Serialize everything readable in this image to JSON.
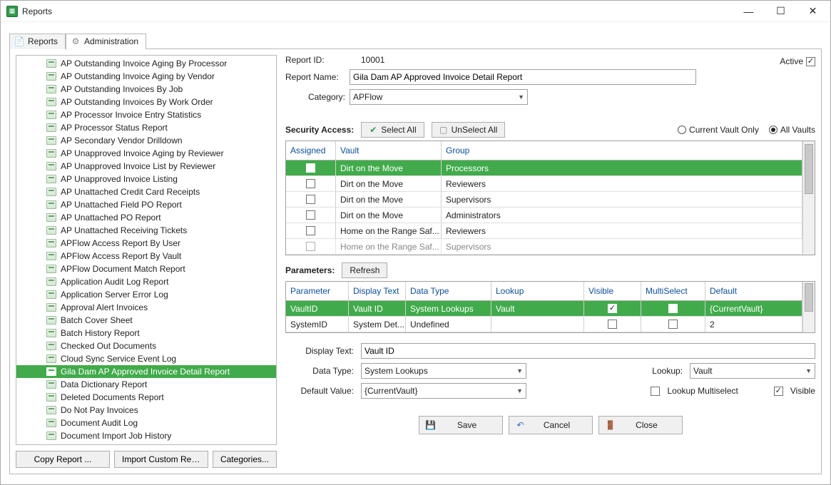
{
  "window": {
    "title": "Reports"
  },
  "tabs": {
    "reports": "Reports",
    "administration": "Administration"
  },
  "tree_items": [
    "AP Outstanding Invoice Aging By Processor",
    "AP Outstanding Invoice Aging by Vendor",
    "AP Outstanding Invoices By Job",
    "AP Outstanding Invoices By Work Order",
    "AP Processor Invoice Entry Statistics",
    "AP Processor Status Report",
    "AP Secondary Vendor Drilldown",
    "AP Unapproved Invoice Aging by Reviewer",
    "AP Unapproved Invoice List by Reviewer",
    "AP Unapproved Invoice Listing",
    "AP Unattached Credit Card Receipts",
    "AP Unattached Field PO Report",
    "AP Unattached PO Report",
    "AP Unattached Receiving Tickets",
    "APFlow Access Report By User",
    "APFlow Access Report By Vault",
    "APFlow Document Match Report",
    "Application Audit Log Report",
    "Application Server Error Log",
    "Approval Alert Invoices",
    "Batch Cover Sheet",
    "Batch History Report",
    "Checked Out Documents",
    "Cloud Sync Service Event Log",
    "Gila Dam AP Approved Invoice Detail Report",
    "Data Dictionary Report",
    "Deleted Documents Report",
    "Do Not Pay Invoices",
    "Document Audit Log",
    "Document Import Job History"
  ],
  "tree_selected_index": 24,
  "left_buttons": {
    "copy": "Copy Report ...",
    "import": "Import Custom Report...",
    "categories": "Categories..."
  },
  "form": {
    "report_id_label": "Report ID:",
    "report_id": "10001",
    "report_name_label": "Report Name:",
    "report_name": "Gila Dam AP Approved Invoice Detail Report",
    "category_label": "Category:",
    "category": "APFlow",
    "active_label": "Active",
    "active_checked": true
  },
  "security": {
    "label": "Security Access:",
    "select_all": "Select All",
    "unselect_all": "UnSelect All",
    "radio_current": "Current Vault Only",
    "radio_all": "All Vaults",
    "radio_selected": "all",
    "headers": {
      "assigned": "Assigned",
      "vault": "Vault",
      "group": "Group"
    },
    "rows": [
      {
        "assigned": false,
        "vault": "Dirt on the Move",
        "group": "Processors",
        "selected": true
      },
      {
        "assigned": false,
        "vault": "Dirt on the Move",
        "group": "Reviewers"
      },
      {
        "assigned": false,
        "vault": "Dirt on the Move",
        "group": "Supervisors"
      },
      {
        "assigned": false,
        "vault": "Dirt on the Move",
        "group": "Administrators"
      },
      {
        "assigned": false,
        "vault": "Home on the Range Saf...",
        "group": "Reviewers"
      },
      {
        "assigned": false,
        "vault": "Home on the Range Saf...",
        "group": "Supervisors",
        "cut": true
      }
    ]
  },
  "parameters": {
    "label": "Parameters:",
    "refresh": "Refresh",
    "headers": {
      "parameter": "Parameter",
      "display": "Display Text",
      "dtype": "Data Type",
      "lookup": "Lookup",
      "visible": "Visible",
      "msel": "MultiSelect",
      "def": "Default"
    },
    "rows": [
      {
        "param": "VaultID",
        "display": "Vault ID",
        "dtype": "System Lookups",
        "lookup": "Vault",
        "visible": true,
        "msel": false,
        "def": "{CurrentVault}",
        "selected": true
      },
      {
        "param": "SystemID",
        "display": "System Det...",
        "dtype": "Undefined",
        "lookup": "",
        "visible": false,
        "msel": false,
        "def": "2"
      }
    ]
  },
  "detail": {
    "display_text_label": "Display Text:",
    "display_text": "Vault ID",
    "data_type_label": "Data Type:",
    "data_type": "System Lookups",
    "lookup_label": "Lookup:",
    "lookup": "Vault",
    "default_label": "Default Value:",
    "default": "{CurrentVault}",
    "lookup_msel_label": "Lookup Multiselect",
    "lookup_msel": false,
    "visible_label": "Visible",
    "visible": true
  },
  "footer": {
    "save": "Save",
    "cancel": "Cancel",
    "close": "Close"
  }
}
